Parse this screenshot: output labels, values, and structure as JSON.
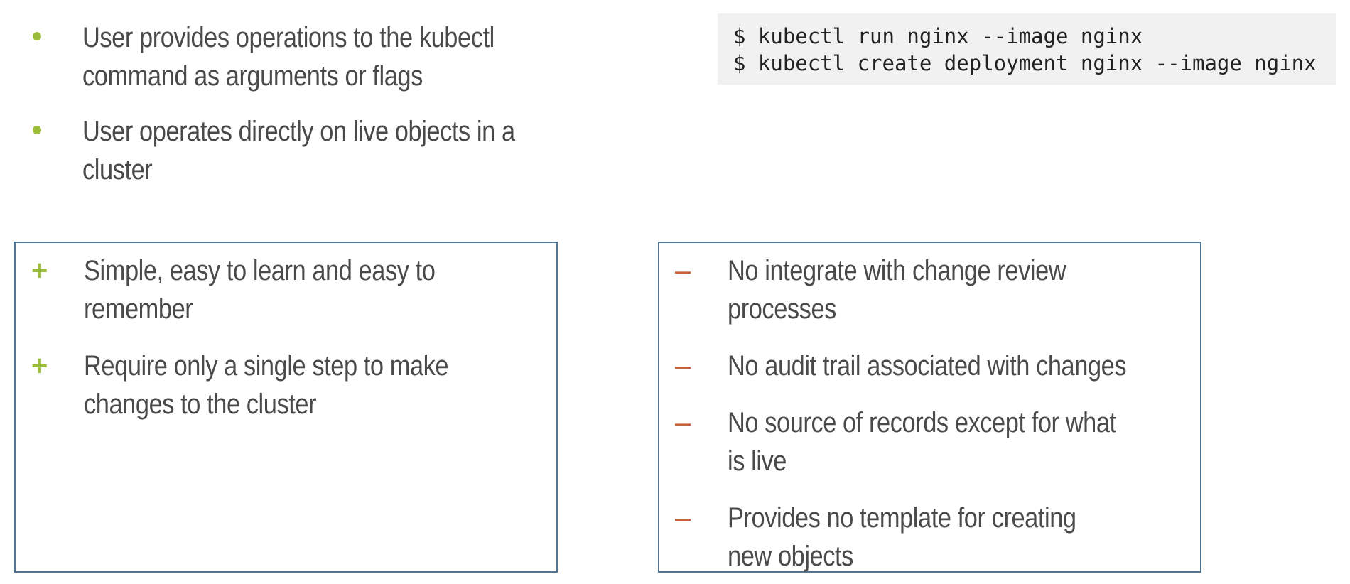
{
  "colors": {
    "bullet_green": "#9bbb3b",
    "minus_orange": "#c8613a",
    "box_border": "#4f7597",
    "text": "#4a4a4a",
    "code_bg": "#f1f1f1"
  },
  "top_bullets": [
    "User provides operations to the kubectl command as arguments or flags",
    "User operates directly on live objects in a cluster"
  ],
  "code": [
    "$ kubectl run nginx --image nginx",
    "$ kubectl create deployment nginx --image nginx"
  ],
  "pros": {
    "marker": "+",
    "items": [
      "Simple, easy to learn and easy to remember",
      "Require only a single step to make changes to the cluster"
    ]
  },
  "cons": {
    "marker": "–",
    "items": [
      "No integrate with change review processes",
      "No audit trail associated with changes",
      "No source of records except for what is live",
      "Provides no template for creating new objects"
    ]
  }
}
